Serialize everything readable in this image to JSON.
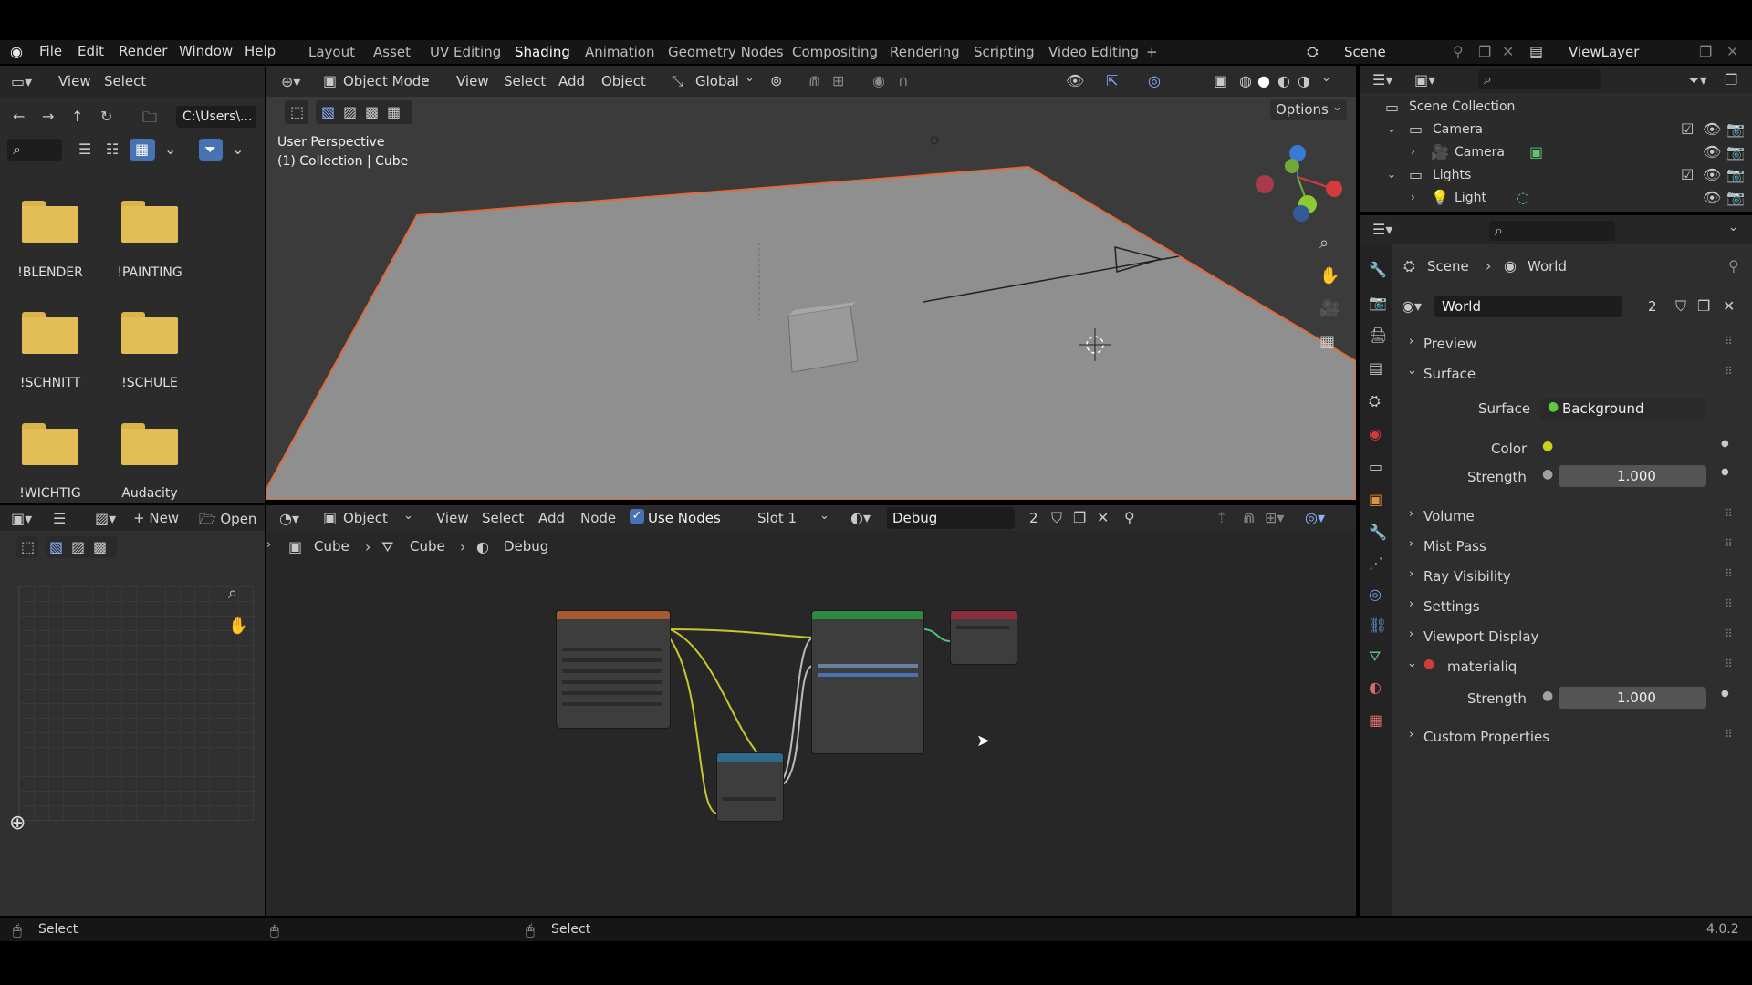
{
  "menu": {
    "items": [
      "File",
      "Edit",
      "Render",
      "Window",
      "Help"
    ]
  },
  "workspaces": {
    "tabs": [
      "Layout",
      "Asset",
      "UV Editing",
      "Shading",
      "Animation",
      "Geometry Nodes",
      "Compositing",
      "Rendering",
      "Scripting",
      "Video Editing"
    ],
    "active": "Shading",
    "add_label": "+"
  },
  "scene": {
    "label": "Scene",
    "view_layer": "ViewLayer"
  },
  "file_browser": {
    "view_label": "View",
    "select_label": "Select",
    "path": "C:\\Users\\...",
    "folders": [
      "!BLENDER",
      "!PAINTING",
      "!SCHNITT",
      "!SCHULE",
      "!WICHTIG",
      "Audacity"
    ]
  },
  "viewport": {
    "mode": "Object Mode",
    "view_label": "View",
    "select_label": "Select",
    "add_label": "Add",
    "object_label": "Object",
    "transform": "Global",
    "options_label": "Options",
    "perspective": "User Perspective",
    "collection": "(1) Collection | Cube"
  },
  "image_editor": {
    "new_label": "New",
    "open_label": "Open"
  },
  "node_editor": {
    "editor_type": "Object",
    "view_label": "View",
    "select_label": "Select",
    "add_label": "Add",
    "node_label": "Node",
    "use_nodes_label": "Use Nodes",
    "slot": "Slot 1",
    "material": "Debug",
    "users": "2",
    "breadcrumb": [
      "Cube",
      "Cube",
      "Debug"
    ]
  },
  "outliner": {
    "root": "Scene Collection",
    "items": [
      {
        "label": "Camera",
        "level": 1
      },
      {
        "label": "Camera",
        "level": 2
      },
      {
        "label": "Lights",
        "level": 1
      },
      {
        "label": "Light",
        "level": 2
      }
    ]
  },
  "properties": {
    "breadcrumb": [
      "Scene",
      "World"
    ],
    "world_name": "World",
    "world_users": "2",
    "sections": {
      "preview": "Preview",
      "surface": "Surface",
      "volume": "Volume",
      "mist_pass": "Mist Pass",
      "ray_visibility": "Ray Visibility",
      "settings": "Settings",
      "viewport_display": "Viewport Display",
      "materialiq": "materialiq",
      "custom_properties": "Custom Properties"
    },
    "surface_label": "Surface",
    "surface_value": "Background",
    "color_label": "Color",
    "strength_label": "Strength",
    "strength_value": "1.000",
    "materialiq_strength_label": "Strength",
    "materialiq_strength_value": "1.000",
    "colors": {
      "accent": "#4772b3",
      "surface_dot": "#62c740",
      "color_dot": "#c8d21a",
      "materialiq_dot": "#d33a3a"
    }
  },
  "status_bar": {
    "left": "Select",
    "middle": "Select",
    "version": "4.0.2"
  }
}
